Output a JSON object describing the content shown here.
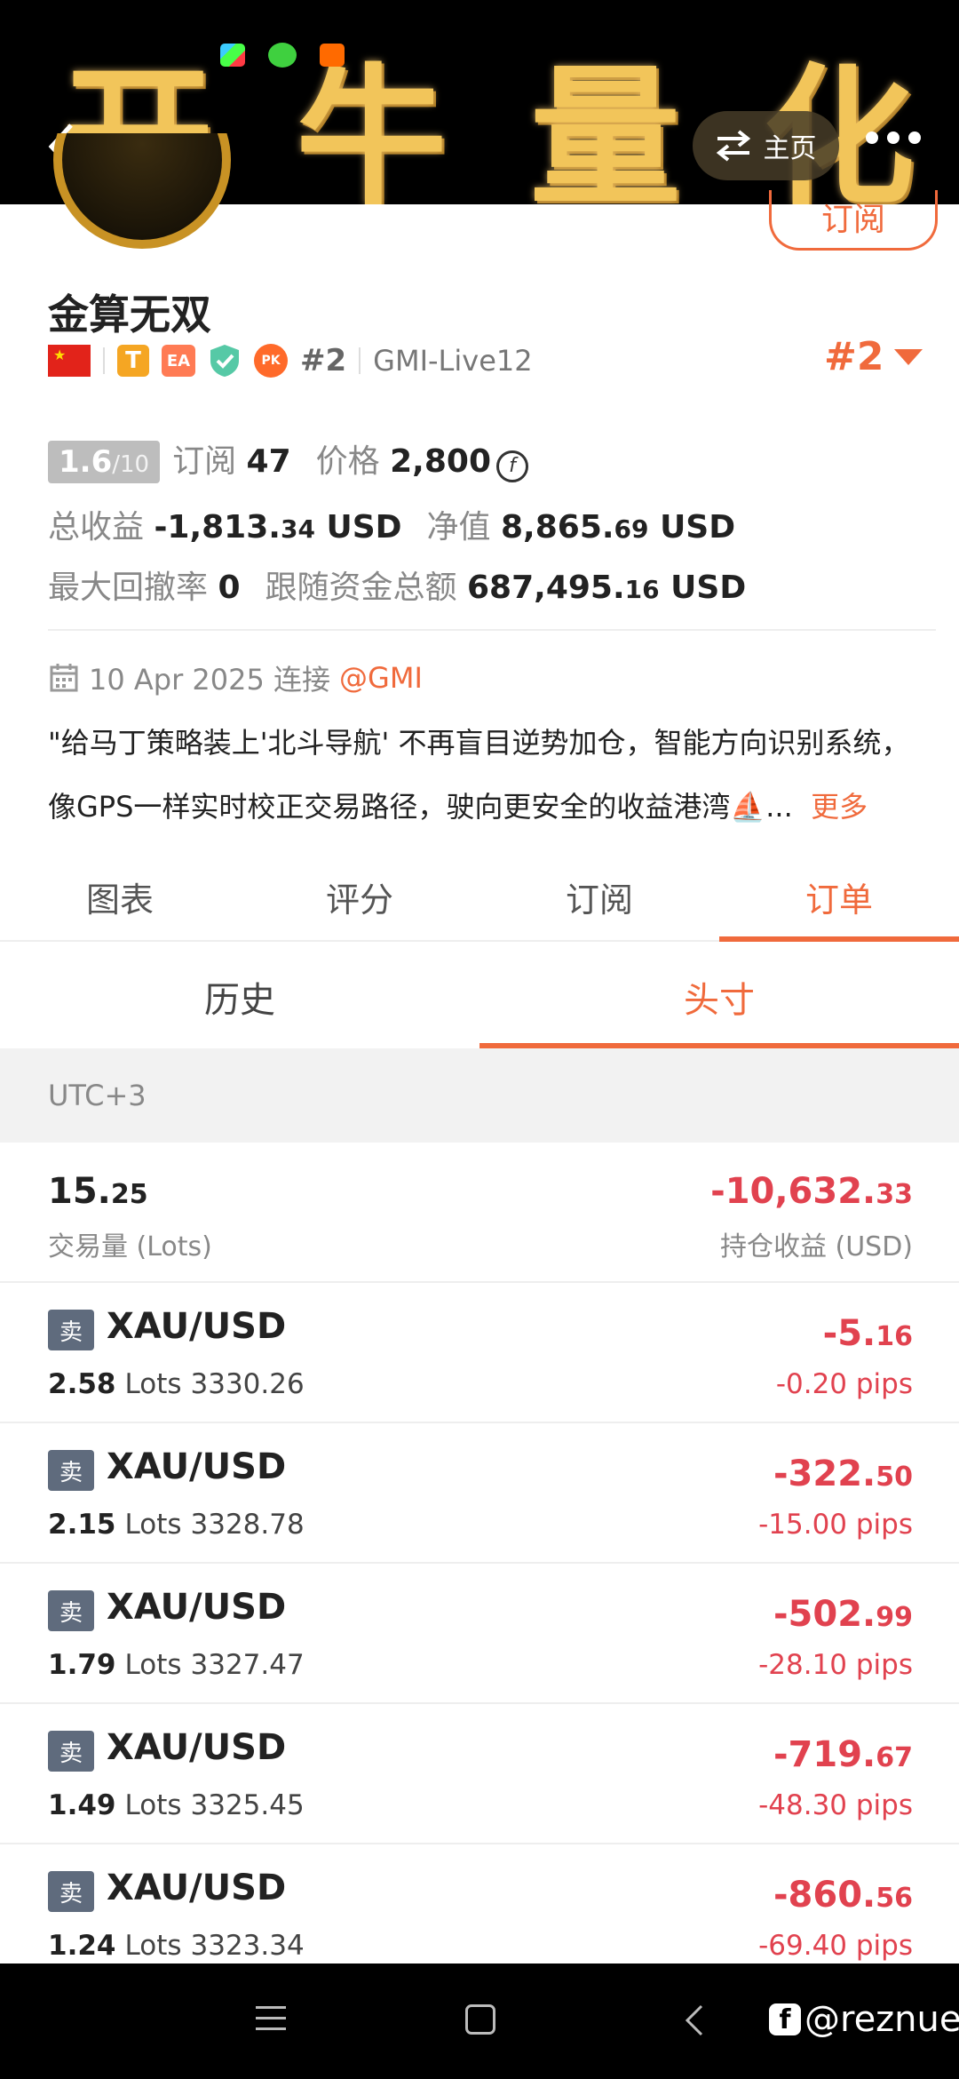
{
  "banner": {
    "chars": [
      "开",
      "牛",
      "量",
      "化"
    ]
  },
  "header": {
    "home_label": "主页"
  },
  "profile": {
    "subscribe_label": "订阅",
    "name": "金算无双",
    "badges": {
      "t": "T",
      "ea": "EA",
      "pk": "PK",
      "rank": "#2",
      "server": "GMI-Live12"
    },
    "rank_big": "#2"
  },
  "stats": {
    "rating_main": "1.6",
    "rating_max": "/10",
    "subs_label": "订阅",
    "subs_value": "47",
    "price_label": "价格",
    "price_value": "2,800",
    "coin_symbol": "f",
    "total_profit_label": "总收益",
    "total_profit_main": "-1,813.",
    "total_profit_dec": "34",
    "currency": "USD",
    "equity_label": "净值",
    "equity_main": "8,865.",
    "equity_dec": "69",
    "drawdown_label": "最大回撤率",
    "drawdown_value": "0",
    "follow_label": "跟随资金总额",
    "follow_main": "687,495.",
    "follow_dec": "16"
  },
  "info": {
    "date_text": "10 Apr 2025 连接",
    "broker_tag": "@GMI",
    "desc_line1": "\"给马丁策略装上'北斗导航' 不再盲目逆势加仓，智能方向识别系统，",
    "desc_line2": "像GPS一样实时校正交易路径，驶向更安全的收益港湾⛵...",
    "more": "更多"
  },
  "tabs": [
    "图表",
    "评分",
    "订阅",
    "订单"
  ],
  "subtabs": [
    "历史",
    "头寸"
  ],
  "timezone": "UTC+3",
  "summary": {
    "volume_main": "15.",
    "volume_dec": "25",
    "volume_label": "交易量 (Lots)",
    "pnl_main": "-10,632.",
    "pnl_dec": "33",
    "pnl_label": "持仓收益 (USD)"
  },
  "positions": [
    {
      "side": "卖",
      "symbol": "XAU/USD",
      "lots": "2.58",
      "lots_unit": "Lots",
      "price": "3330.26",
      "pnl_main": "-5.",
      "pnl_dec": "16",
      "pips": "-0.20 pips"
    },
    {
      "side": "卖",
      "symbol": "XAU/USD",
      "lots": "2.15",
      "lots_unit": "Lots",
      "price": "3328.78",
      "pnl_main": "-322.",
      "pnl_dec": "50",
      "pips": "-15.00 pips"
    },
    {
      "side": "卖",
      "symbol": "XAU/USD",
      "lots": "1.79",
      "lots_unit": "Lots",
      "price": "3327.47",
      "pnl_main": "-502.",
      "pnl_dec": "99",
      "pips": "-28.10 pips"
    },
    {
      "side": "卖",
      "symbol": "XAU/USD",
      "lots": "1.49",
      "lots_unit": "Lots",
      "price": "3325.45",
      "pnl_main": "-719.",
      "pnl_dec": "67",
      "pips": "-48.30 pips"
    },
    {
      "side": "卖",
      "symbol": "XAU/USD",
      "lots": "1.24",
      "lots_unit": "Lots",
      "price": "3323.34",
      "pnl_main": "-860.",
      "pnl_dec": "56",
      "pips": "-69.40 pips"
    }
  ],
  "watermark": {
    "fb_letter": "f",
    "handle": "@reznue"
  },
  "colors": {
    "accent": "#f06a3c",
    "loss": "#e1424f",
    "side_badge": "#5f6b7d"
  }
}
